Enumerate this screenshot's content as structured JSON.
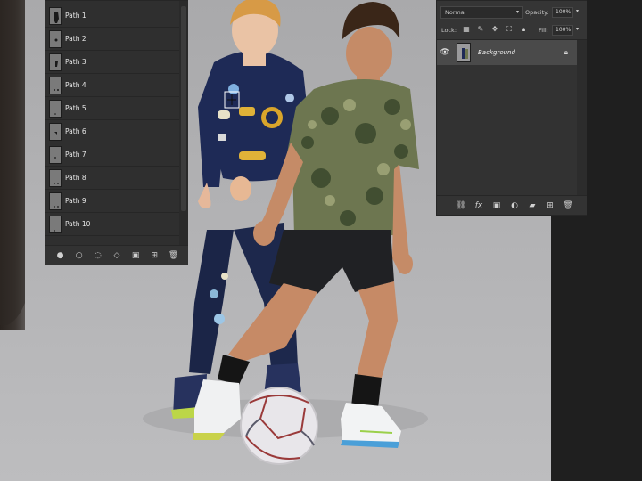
{
  "paths_panel": {
    "items": [
      {
        "label": "Path 1"
      },
      {
        "label": "Path 2"
      },
      {
        "label": "Path 3"
      },
      {
        "label": "Path 4"
      },
      {
        "label": "Path 5"
      },
      {
        "label": "Path 6"
      },
      {
        "label": "Path 7"
      },
      {
        "label": "Path 8"
      },
      {
        "label": "Path 9"
      },
      {
        "label": "Path 10"
      }
    ],
    "footer_icons": [
      "fill-path-icon",
      "stroke-path-icon",
      "load-selection-icon",
      "make-work-path-icon",
      "add-mask-icon",
      "new-path-icon",
      "delete-path-icon"
    ]
  },
  "layers_panel": {
    "blend_mode": "Normal",
    "opacity_label": "Opacity:",
    "opacity_value": "100%",
    "lock_label": "Lock:",
    "fill_label": "Fill:",
    "fill_value": "100%",
    "layer_name": "Background",
    "footer_icons": [
      "link-layers-icon",
      "fx-icon",
      "add-mask-icon",
      "adjustment-layer-icon",
      "group-folder-icon",
      "new-layer-icon",
      "delete-layer-icon"
    ]
  },
  "colors": {
    "panel_bg": "#323232",
    "selected_row": "#4a4a4a",
    "canvas_bg": "#b0b0b2"
  }
}
